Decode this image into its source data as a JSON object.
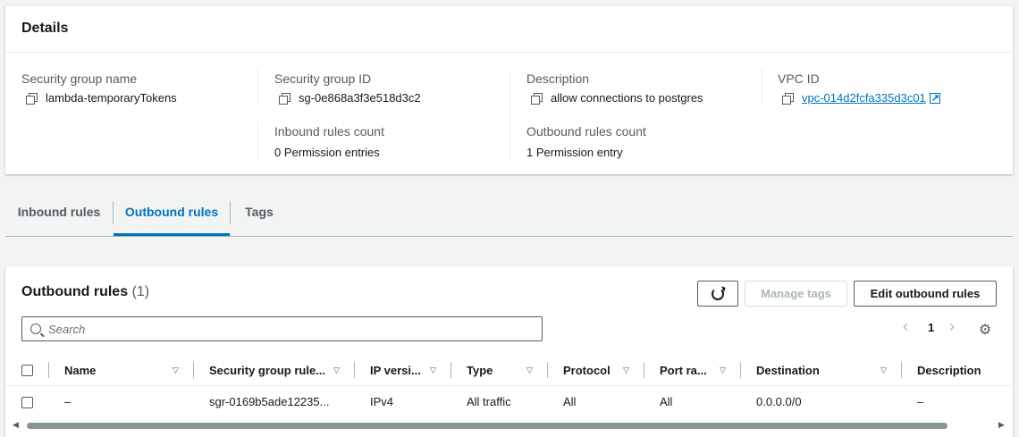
{
  "details": {
    "title": "Details",
    "sg_name_label": "Security group name",
    "sg_name_value": "lambda-temporaryTokens",
    "sg_id_label": "Security group ID",
    "sg_id_value": "sg-0e868a3f3e518d3c2",
    "description_label": "Description",
    "description_value": "allow connections to postgres",
    "vpc_label": "VPC ID",
    "vpc_value": "vpc-014d2fcfa335d3c01",
    "inbound_count_label": "Inbound rules count",
    "inbound_count_value": "0 Permission entries",
    "outbound_count_label": "Outbound rules count",
    "outbound_count_value": "1 Permission entry"
  },
  "tabs": [
    "Inbound rules",
    "Outbound rules",
    "Tags"
  ],
  "outbound": {
    "title": "Outbound rules",
    "count": "(1)",
    "manage_tags": "Manage tags",
    "edit_rules": "Edit outbound rules",
    "search_placeholder": "Search",
    "page": "1",
    "columns": [
      "Name",
      "Security group rule...",
      "IP versi...",
      "Type",
      "Protocol",
      "Port ra...",
      "Destination",
      "Description"
    ],
    "rows": [
      [
        "–",
        "sgr-0169b5ade12235...",
        "IPv4",
        "All traffic",
        "All",
        "All",
        "0.0.0.0/0",
        "–"
      ]
    ]
  },
  "colors": {
    "accent": "#0073bb",
    "text": "#16191f",
    "muted": "#545b64",
    "background": "#f2f3f3"
  }
}
